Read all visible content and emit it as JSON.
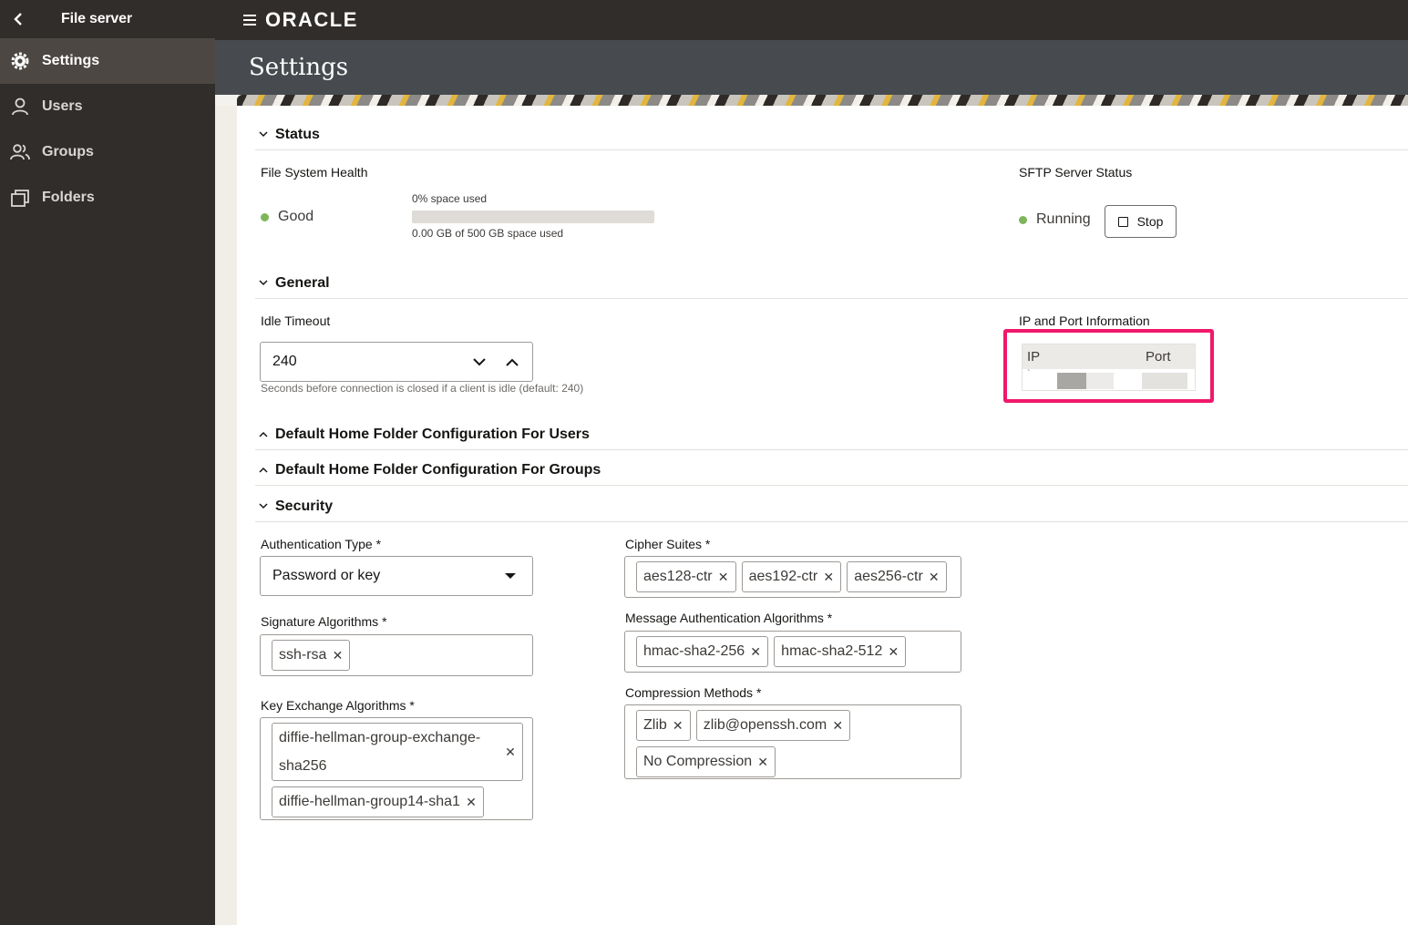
{
  "app": {
    "title": "File server",
    "logo": "ORACLE"
  },
  "sidebar": {
    "items": [
      {
        "label": "Settings",
        "icon": "gear-icon",
        "active": true
      },
      {
        "label": "Users",
        "icon": "user-icon",
        "active": false
      },
      {
        "label": "Groups",
        "icon": "group-icon",
        "active": false
      },
      {
        "label": "Folders",
        "icon": "folder-icon",
        "active": false
      }
    ]
  },
  "page": {
    "title": "Settings"
  },
  "status": {
    "heading": "Status",
    "fs_health_label": "File System Health",
    "fs_health_value": "Good",
    "space_used_pct_label": "0% space used",
    "space_used_fraction": 0.0,
    "space_used_detail": "0.00 GB of 500 GB space used",
    "sftp_label": "SFTP Server Status",
    "sftp_value": "Running",
    "stop_button": "Stop",
    "status_color": "#7fb55b"
  },
  "general": {
    "heading": "General",
    "idle_timeout_label": "Idle Timeout",
    "idle_timeout_value": "240",
    "idle_timeout_help": "Seconds before connection is closed if a client is idle (default: 240)",
    "ip_port_label": "IP and Port Information",
    "ip_col": "IP",
    "port_col": "Port",
    "ip_row_mark": "`"
  },
  "sections": {
    "home_users": "Default Home Folder Configuration For Users",
    "home_groups": "Default Home Folder Configuration For Groups"
  },
  "security": {
    "heading": "Security",
    "auth_type_label": "Authentication Type *",
    "auth_type_value": "Password or key",
    "sig_label": "Signature Algorithms *",
    "sig_values": [
      "ssh-rsa"
    ],
    "kex_label": "Key Exchange Algorithms *",
    "kex_values": [
      "diffie-hellman-group-exchange-sha256",
      "diffie-hellman-group14-sha1"
    ],
    "cipher_label": "Cipher Suites *",
    "cipher_values": [
      "aes128-ctr",
      "aes192-ctr",
      "aes256-ctr"
    ],
    "mac_label": "Message Authentication Algorithms *",
    "mac_values": [
      "hmac-sha2-256",
      "hmac-sha2-512"
    ],
    "comp_label": "Compression Methods *",
    "comp_values": [
      "Zlib",
      "zlib@openssh.com",
      "No Compression"
    ]
  },
  "highlight_color": "#f0186b"
}
